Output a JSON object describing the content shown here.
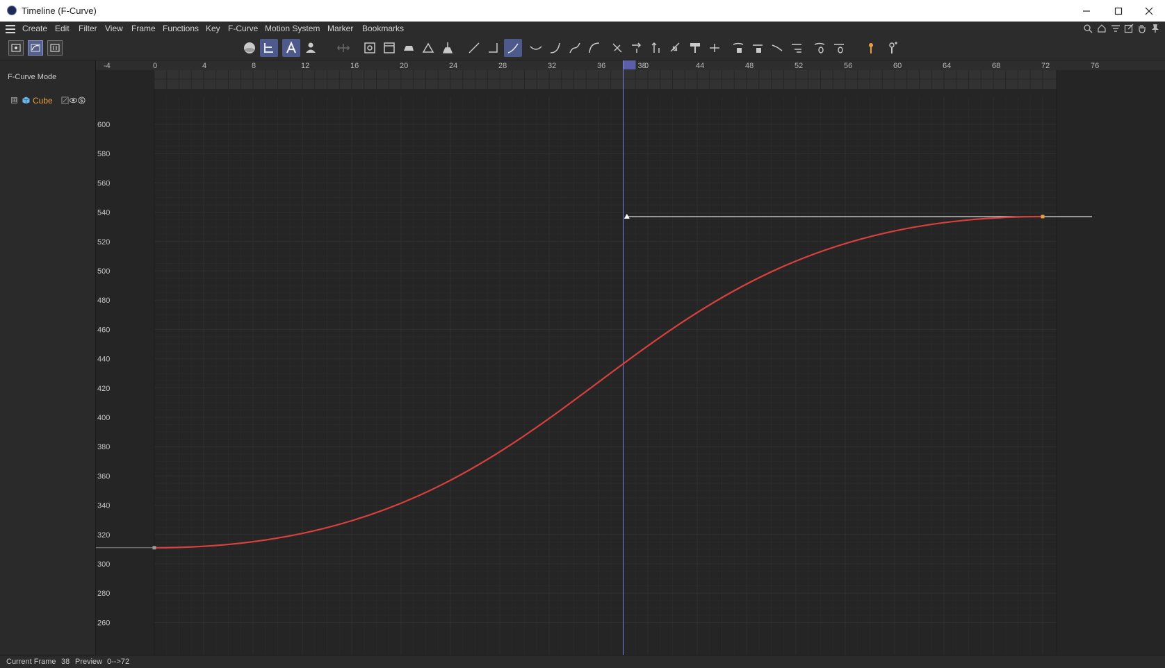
{
  "window": {
    "title": "Timeline (F-Curve)"
  },
  "menu": {
    "items": [
      "Create",
      "Edit",
      "Filter",
      "View",
      "Frame",
      "Functions",
      "Key",
      "F-Curve",
      "Motion System",
      "Marker",
      "Bookmarks"
    ]
  },
  "icons": {
    "right_menu": [
      "search-icon",
      "home-icon",
      "filter-icon",
      "open-window-icon",
      "hand-icon",
      "pin-icon"
    ],
    "toolbar": [
      "sphere-icon",
      "hierarchy-icon",
      "text-icon",
      "person-icon",
      "move-icon",
      "frame-all-icon",
      "frame-selected-icon",
      "camera-icon",
      "triangle-icon",
      "broom-icon",
      "linear-icon",
      "step-icon",
      "spline-icon",
      "ease-icon",
      "ease-in-icon",
      "ease-out-icon",
      "ease-curve-icon",
      "break-tangent-icon",
      "scale-tangent-icon",
      "align-tangent-icon",
      "auto-tangent-icon",
      "paint-icon",
      "split-icon",
      "lock-value-icon",
      "lock-time-icon",
      "zero-angle-icon",
      "zero-length-icon",
      "zero-key-icon",
      "zero-tangent-icon",
      "marker-icon",
      "marker-add-icon"
    ]
  },
  "left_panel": {
    "mode_label": "F-Curve Mode",
    "object_name": "Cube",
    "expand_glyph": "⊞"
  },
  "timeline": {
    "current_frame": 38,
    "current_frame_label": "38",
    "frame_ticks": [
      "-4",
      "0",
      "4",
      "8",
      "12",
      "16",
      "20",
      "24",
      "28",
      "32",
      "36",
      "40",
      "44",
      "48",
      "52",
      "56",
      "60",
      "64",
      "68",
      "72",
      "76"
    ],
    "value_ticks": [
      "600",
      "580",
      "560",
      "540",
      "520",
      "500",
      "480",
      "460",
      "440",
      "420",
      "400",
      "380",
      "360",
      "340",
      "320",
      "300",
      "280",
      "260"
    ]
  },
  "colors": {
    "curve": "#d8403e",
    "playhead": "#7f7fdf",
    "key_end": "#e8a040",
    "accent": "#4f5a8c"
  },
  "chart_data": {
    "type": "line",
    "xlabel": "",
    "ylabel": "",
    "xlim": [
      -4,
      76
    ],
    "ylim": [
      260,
      610
    ],
    "grid": true,
    "series": [
      {
        "x": [
          0,
          72
        ],
        "values": [
          311,
          537
        ],
        "interpolation": "ease-in-out"
      }
    ],
    "playhead_frame": 38,
    "tangent_line": {
      "x": [
        38.3,
        76
      ],
      "y": [
        537,
        537
      ]
    }
  },
  "status": {
    "label_current": "Current Frame",
    "current_value": "38",
    "label_preview": "Preview",
    "preview_range": "0-->72"
  }
}
